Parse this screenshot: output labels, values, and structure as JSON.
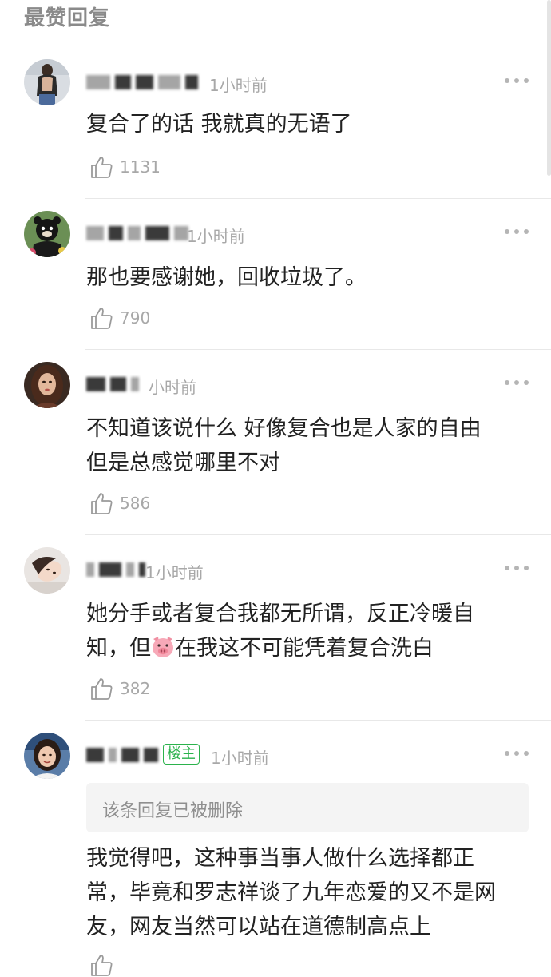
{
  "section_title": "最赞回复",
  "comments": [
    {
      "time": "1小时前",
      "text": "复合了的话 我就真的无语了",
      "likes": "1131",
      "avatar": "avatar-woman-back"
    },
    {
      "time": "1小时前",
      "text": "那也要感谢她，回收垃圾了。",
      "likes": "790",
      "avatar": "avatar-black-bear"
    },
    {
      "time": "小时前",
      "text_lines": [
        "不知道该说什么 好像复合也是人家的自由",
        "但是总感觉哪里不对"
      ],
      "likes": "586",
      "avatar": "avatar-woman-portrait"
    },
    {
      "time": "1小时前",
      "text_line1": "她分手或者复合我都无所谓，反正冷暖自",
      "text_line2_a": "知，但",
      "text_line2_b": "在我这不可能凭着复合洗白",
      "emoji": "pig-face-emoji",
      "likes": "382",
      "avatar": "avatar-girl-lying"
    },
    {
      "badge": "楼主",
      "time": "1小时前",
      "deleted_notice": "该条回复已被删除",
      "text_lines": [
        "我觉得吧，这种事当事人做什么选择都正",
        "常，毕竟和罗志祥谈了九年恋爱的又不是网",
        "友，网友当然可以站在道德制高点上"
      ],
      "avatar": "avatar-woman-selfie"
    }
  ],
  "colors": {
    "badge_green": "#2bb24c",
    "muted": "#a8a8a8",
    "text": "#222222"
  }
}
